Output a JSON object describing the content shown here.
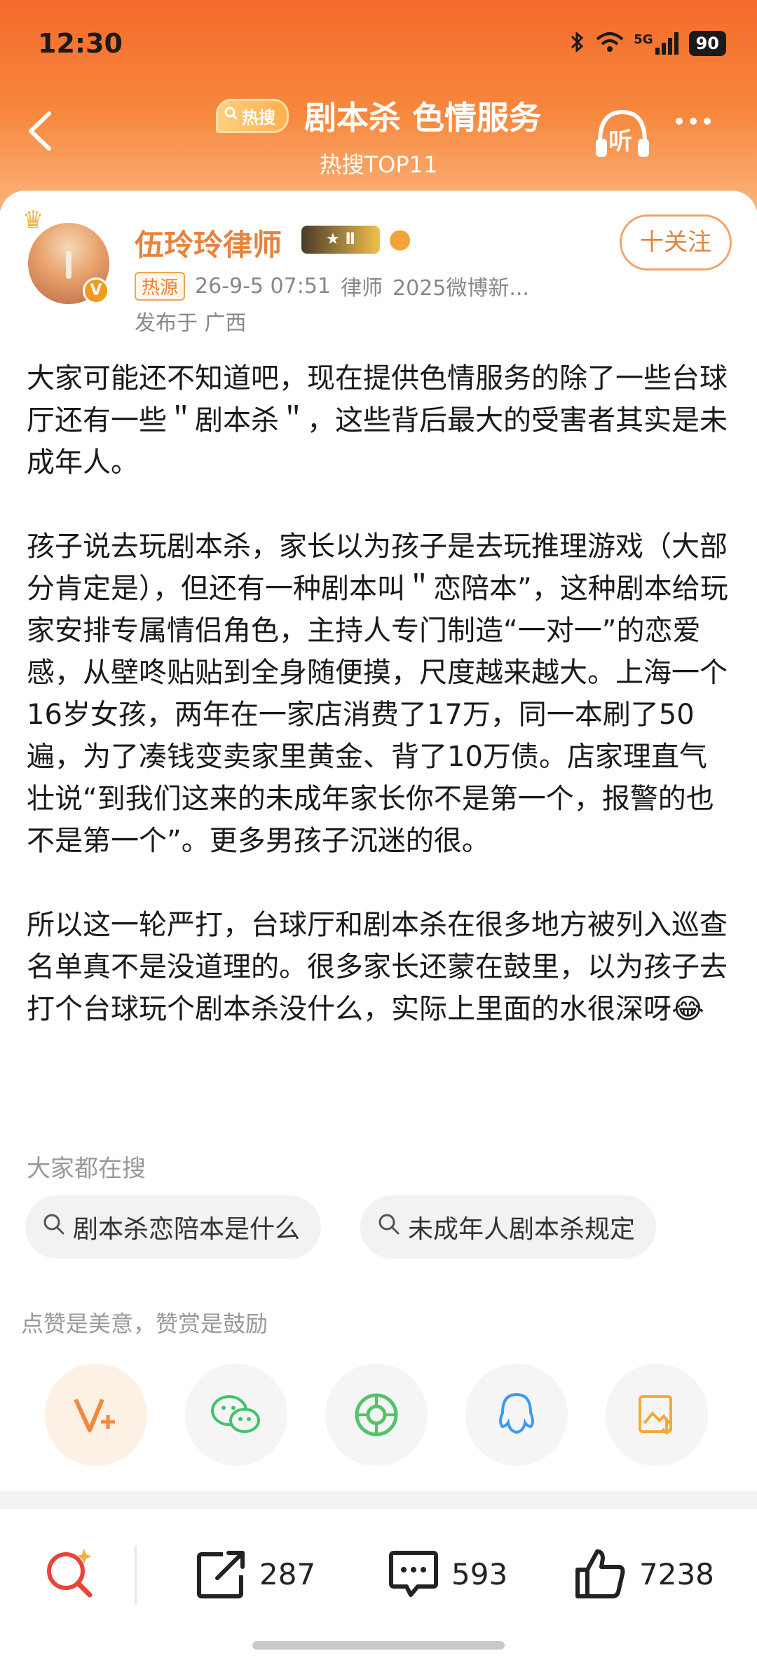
{
  "status_bar": {
    "time": "12:30",
    "network": "5G",
    "battery": "90"
  },
  "header": {
    "hot_badge": "热搜",
    "title": "剧本杀 色情服务",
    "subtitle": "热搜TOP11",
    "listen_label": "听"
  },
  "post": {
    "author": "伍玲玲律师",
    "level": "Ⅱ",
    "follow_label": "十关注",
    "hot_source": "热源",
    "time": "26-9-5 07:51",
    "role": "律师",
    "extra": "2025微博新...",
    "location": "发布于 广西",
    "paragraphs": [
      "大家可能还不知道吧，现在提供色情服务的除了一些台球厅还有一些＂剧本杀＂，这些背后最大的受害者其实是未成年人。",
      "孩子说去玩剧本杀，家长以为孩子是去玩推理游戏（大部分肯定是），但还有一种剧本叫＂恋陪本”，这种剧本给玩家安排专属情侣角色，主持人专门制造“一对一”的恋爱感，从壁咚贴贴到全身随便摸，尺度越来越大。上海一个16岁女孩，两年在一家店消费了17万，同一本刷了50遍，为了凑钱变卖家里黄金、背了10万债。店家理直气壮说“到我们这来的未成年家长你不是第一个，报警的也不是第一个”。更多男孩子沉迷的很。",
      "所以这一轮严打，台球厅和剧本杀在很多地方被列入巡查名单真不是没道理的。很多家长还蒙在鼓里，以为孩子去打个台球玩个剧本杀没什么，实际上里面的水很深呀😂"
    ]
  },
  "related": {
    "label": "大家都在搜",
    "chips": [
      "剧本杀恋陪本是什么",
      "未成年人剧本杀规定"
    ]
  },
  "praise_note": "点赞是美意，赞赏是鼓励",
  "toolbar": {
    "reposts": "287",
    "comments": "593",
    "likes": "7238"
  }
}
